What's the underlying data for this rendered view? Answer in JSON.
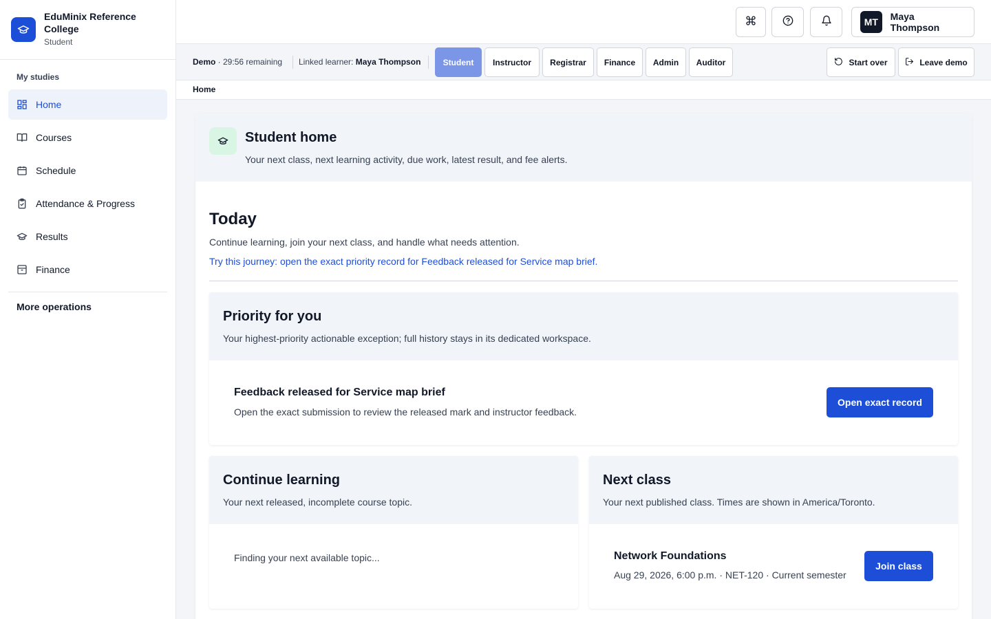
{
  "brand": {
    "name": "EduMinix Reference College",
    "role": "Student",
    "logo_icon": "graduation-cap-icon"
  },
  "sidebar": {
    "heading": "My studies",
    "items": [
      {
        "label": "Home",
        "icon": "dashboard-icon",
        "active": true
      },
      {
        "label": "Courses",
        "icon": "book-open-icon",
        "active": false
      },
      {
        "label": "Schedule",
        "icon": "calendar-icon",
        "active": false
      },
      {
        "label": "Attendance & Progress",
        "icon": "clipboard-check-icon",
        "active": false
      },
      {
        "label": "Results",
        "icon": "graduation-cap-icon",
        "active": false
      },
      {
        "label": "Finance",
        "icon": "archive-icon",
        "active": false
      }
    ],
    "more": "More operations"
  },
  "topbar": {
    "icons": [
      "command-icon",
      "help-icon",
      "bell-icon"
    ],
    "user": {
      "initials": "MT",
      "name": "Maya Thompson"
    }
  },
  "demo": {
    "label": "Demo",
    "remaining": " · 29:56 remaining",
    "linked_label": "Linked learner: ",
    "linked_name": "Maya Thompson",
    "roles": [
      "Student",
      "Instructor",
      "Registrar",
      "Finance",
      "Admin",
      "Auditor"
    ],
    "active_role": "Student",
    "start_over": "Start over",
    "leave_demo": "Leave demo"
  },
  "breadcrumb": "Home",
  "page": {
    "title": "Student home",
    "subtitle": "Your next class, next learning activity, due work, latest result, and fee alerts.",
    "today": {
      "title": "Today",
      "subtitle": "Continue learning, join your next class, and handle what needs attention.",
      "journey": "Try this journey: open the exact priority record for Feedback released for Service map brief."
    },
    "priority": {
      "title": "Priority for you",
      "subtitle": "Your highest-priority actionable exception; full history stays in its dedicated workspace.",
      "item_title": "Feedback released for Service map brief",
      "item_sub": "Open the exact submission to review the released mark and instructor feedback.",
      "button": "Open exact record"
    },
    "continue": {
      "title": "Continue learning",
      "subtitle": "Your next released, incomplete course topic.",
      "loading": "Finding your next available topic..."
    },
    "next_class": {
      "title": "Next class",
      "subtitle": "Your next published class. Times are shown in America/Toronto.",
      "course": "Network Foundations",
      "details": "Aug 29, 2026, 6:00 p.m. · NET-120 · Current semester",
      "button": "Join class"
    }
  },
  "colors": {
    "accent": "#1d4ed8",
    "active_role_bg": "#7b96e6",
    "page_bg": "#f3f5f9"
  }
}
